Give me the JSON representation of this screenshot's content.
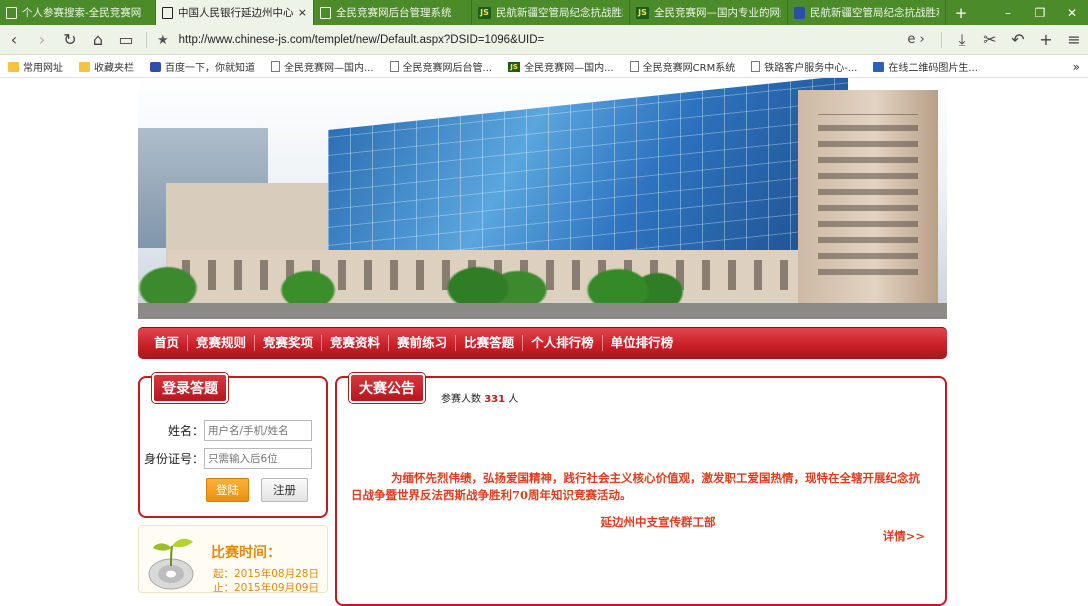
{
  "browser": {
    "tabs": [
      {
        "title": "个人参赛搜索-全民竞赛网",
        "icon": "page-icon"
      },
      {
        "title": "中国人民银行延边州中心支",
        "icon": "page-icon",
        "active": true
      },
      {
        "title": "全民竞赛网后台管理系统",
        "icon": "page-icon"
      },
      {
        "title": "民航新疆空管局纪念抗战胜利",
        "icon": "js-icon",
        "icon_text": "JS"
      },
      {
        "title": "全民竞赛网—国内专业的网络",
        "icon": "js-icon",
        "icon_text": "JS"
      },
      {
        "title": "民航新疆空管局纪念抗战胜利",
        "icon": "baidu-icon"
      }
    ],
    "new_tab": "+",
    "tab_close": "×",
    "window_controls": {
      "minimize": "–",
      "restore": "❐",
      "close": "✕"
    },
    "nav": {
      "back": "‹",
      "forward": "›",
      "reload": "↻",
      "home": "⌂",
      "reader": "▭",
      "star": "★",
      "ie": "e ›",
      "download": "⤓",
      "cut": "✂",
      "undo": "↶",
      "add": "+",
      "menu": "≡"
    },
    "url": "http://www.chinese-js.com/templet/new/Default.aspx?DSID=1096&UID=",
    "bookmarks": [
      {
        "label": "常用网址",
        "icon": "folder"
      },
      {
        "label": "收藏夹栏",
        "icon": "folder"
      },
      {
        "label": "百度一下，你就知道",
        "icon": "baidu"
      },
      {
        "label": "全民竞赛网—国内...",
        "icon": "page"
      },
      {
        "label": "全民竞赛网后台管...",
        "icon": "page"
      },
      {
        "label": "全民竞赛网—国内...",
        "icon": "js",
        "icon_text": "JS"
      },
      {
        "label": "全民竞赛网CRM系统",
        "icon": "page"
      },
      {
        "label": "铁路客户服务中心-...",
        "icon": "page"
      },
      {
        "label": "在线二维码图片生...",
        "icon": "qr"
      }
    ],
    "bookmarks_more": "»"
  },
  "site": {
    "menu": [
      "首页",
      "竞赛规则",
      "竞赛奖项",
      "竞赛资料",
      "赛前练习",
      "比赛答题",
      "个人排行榜",
      "单位排行榜"
    ],
    "login": {
      "title": "登录答题",
      "name_label": "姓名：",
      "name_placeholder": "用户名/手机/姓名",
      "id_label": "身份证号：",
      "id_placeholder": "只需输入后6位",
      "login_button": "登陆",
      "register_button": "注册"
    },
    "time": {
      "title": "比赛时间：",
      "start": "起：2015年08月28日",
      "end": "止：2015年09月09日"
    },
    "notice": {
      "title": "大赛公告",
      "count_prefix": "参赛人数",
      "count": "331",
      "count_suffix": "人",
      "text": "为缅怀先烈伟绩，弘扬爱国精神，践行社会主义核心价值观，激发职工爱国热情，现特在全辖开展纪念抗日战争暨世界反法西斯战争胜利70周年知识竞赛活动。",
      "signature": "延边州中支宣传群工部",
      "more": "详情>>"
    }
  },
  "colors": {
    "brand_red": "#c5191f",
    "notice_text": "#e23a1c",
    "accent_orange": "#e58a0c",
    "tabbar_green": "#4b8b2a"
  }
}
